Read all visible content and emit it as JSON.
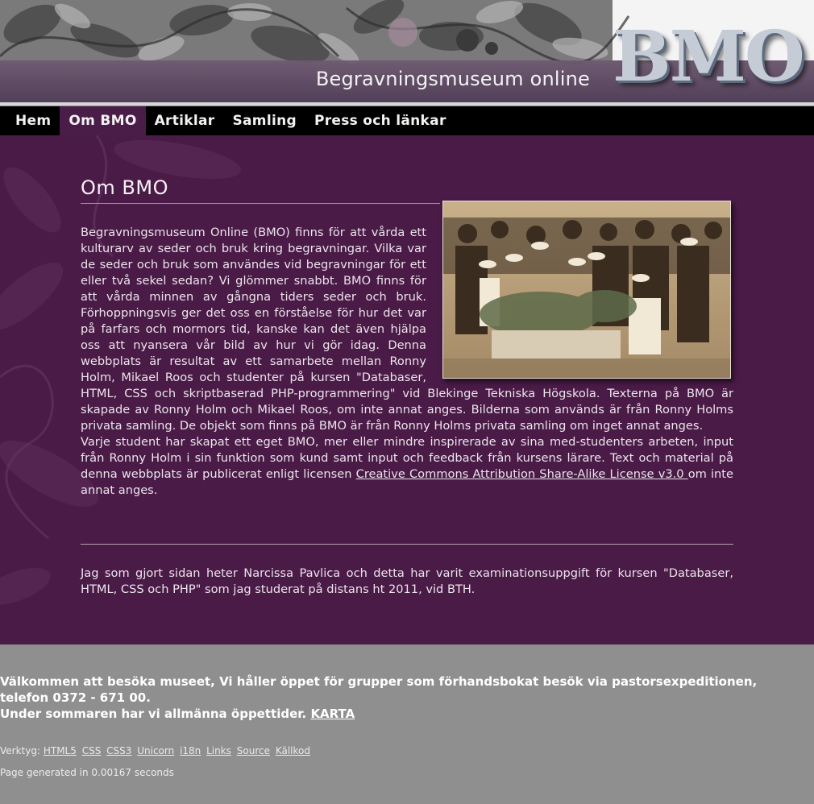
{
  "header": {
    "logo": "BMO",
    "subtitle": "Begravningsmuseum online"
  },
  "nav": {
    "items": [
      {
        "label": "Hem"
      },
      {
        "label": "Om BMO",
        "active": true
      },
      {
        "label": "Artiklar"
      },
      {
        "label": "Samling"
      },
      {
        "label": "Press och länkar"
      }
    ]
  },
  "main": {
    "title": "Om BMO",
    "paragraph1": "Begravningsmuseum Online (BMO) finns för att vårda ett kulturarv av seder och bruk kring begravningar. Vilka var de seder och bruk som användes vid begravningar för ett eller två sekel sedan? Vi glömmer snabbt. BMO finns för att vårda minnen av gångna tiders seder och bruk. Förhoppningsvis ger det oss en förståelse för hur det var på farfars och mormors tid, kanske kan det även hjälpa oss att nyansera vår bild av hur vi gör idag. Denna webbplats är resultat av ett samarbete mellan Ronny Holm, Mikael Roos och studenter på kursen \"Databaser, HTML, CSS och skriptbaserad PHP-programmering\" vid Blekinge Tekniska Högskola. Texterna på BMO är skapade av Ronny Holm och Mikael Roos, om inte annat anges. Bilderna som används är från Ronny Holms privata samling. De objekt som finns på BMO är från Ronny Holms privata samling om inget annat anges.",
    "paragraph2_before": "Varje student har skapat ett eget BMO, mer eller mindre inspirerade av sina med-studenters arbeten, input från Ronny Holm i sin funktion som kund samt input och feedback från kursens lärare. Text och material på denna webbplats är publicerat enligt licensen ",
    "license_link": "Creative Commons Attribution Share-Alike License v3.0 ",
    "paragraph2_after": "om inte annat anges.",
    "credit": "Jag som gjort sidan heter Narcissa Pavlica och detta har varit examinationsuppgift för kursen \"Databaser, HTML, CSS och PHP\" som jag studerat på distans ht 2011, vid BTH."
  },
  "footer": {
    "welcome_line1": "Välkommen att besöka museet, Vi håller öppet för grupper som förhandsbokat besök via pastorsexpeditionen, telefon 0372 - 671 00.",
    "welcome_line2": "Under sommaren har vi allmänna öppettider. ",
    "map_link": "KARTA",
    "tools_label": "Verktyg:",
    "tools": [
      "HTML5",
      "CSS",
      "CSS3",
      "Unicorn",
      "i18n",
      "Links",
      "Source",
      "Källkod"
    ],
    "generated": "Page generated in 0.00167 seconds"
  },
  "colors": {
    "nav_active": "#4a1c48",
    "main_bg": "#4a1b47",
    "footer_bg": "#8f8f8f"
  },
  "icons": [
    "floral-header-art",
    "sepia-funeral-photo"
  ]
}
